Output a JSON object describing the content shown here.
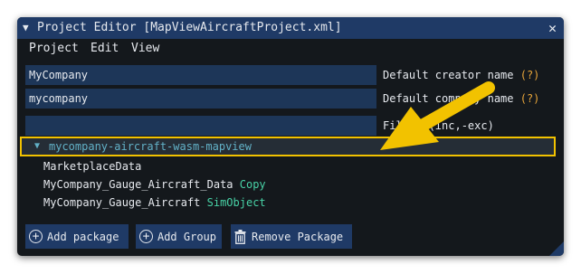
{
  "window": {
    "title": "Project Editor [MapViewAircraftProject.xml]",
    "collapse_glyph": "▼",
    "close_glyph": "✕"
  },
  "menu": {
    "items": [
      "Project",
      "Edit",
      "View"
    ]
  },
  "fields": [
    {
      "value": "MyCompany",
      "label": "Default creator name",
      "help": "(?)"
    },
    {
      "value": "mycompany",
      "label": "Default company name",
      "help": "(?)"
    },
    {
      "value": "",
      "label": "Filter (inc,-exc)",
      "help": ""
    }
  ],
  "tree": {
    "root": {
      "glyph": "▼",
      "label": "mycompany-aircraft-wasm-mapview"
    },
    "children": [
      {
        "label": "MarketplaceData",
        "tag": ""
      },
      {
        "label": "MyCompany_Gauge_Aircraft_Data",
        "tag": "Copy"
      },
      {
        "label": "MyCompany_Gauge_Aircraft",
        "tag": "SimObject"
      }
    ]
  },
  "buttons": {
    "add_package": "Add package",
    "add_group": "Add Group",
    "remove_package": "Remove Package"
  },
  "colors": {
    "title_bar": "#1f3a66",
    "field_bg": "#1d3658",
    "help_text": "#e8a53a",
    "highlight_border": "#f2c200",
    "tree_root_text": "#62b1c7",
    "tag_text": "#48d2a6",
    "annotation_arrow": "#f2c200"
  },
  "icons": [
    "collapse-triangle-icon",
    "close-icon",
    "expand-arrow-icon",
    "plus-circle-icon",
    "trash-icon",
    "resize-grip-icon",
    "annotation-arrow"
  ]
}
